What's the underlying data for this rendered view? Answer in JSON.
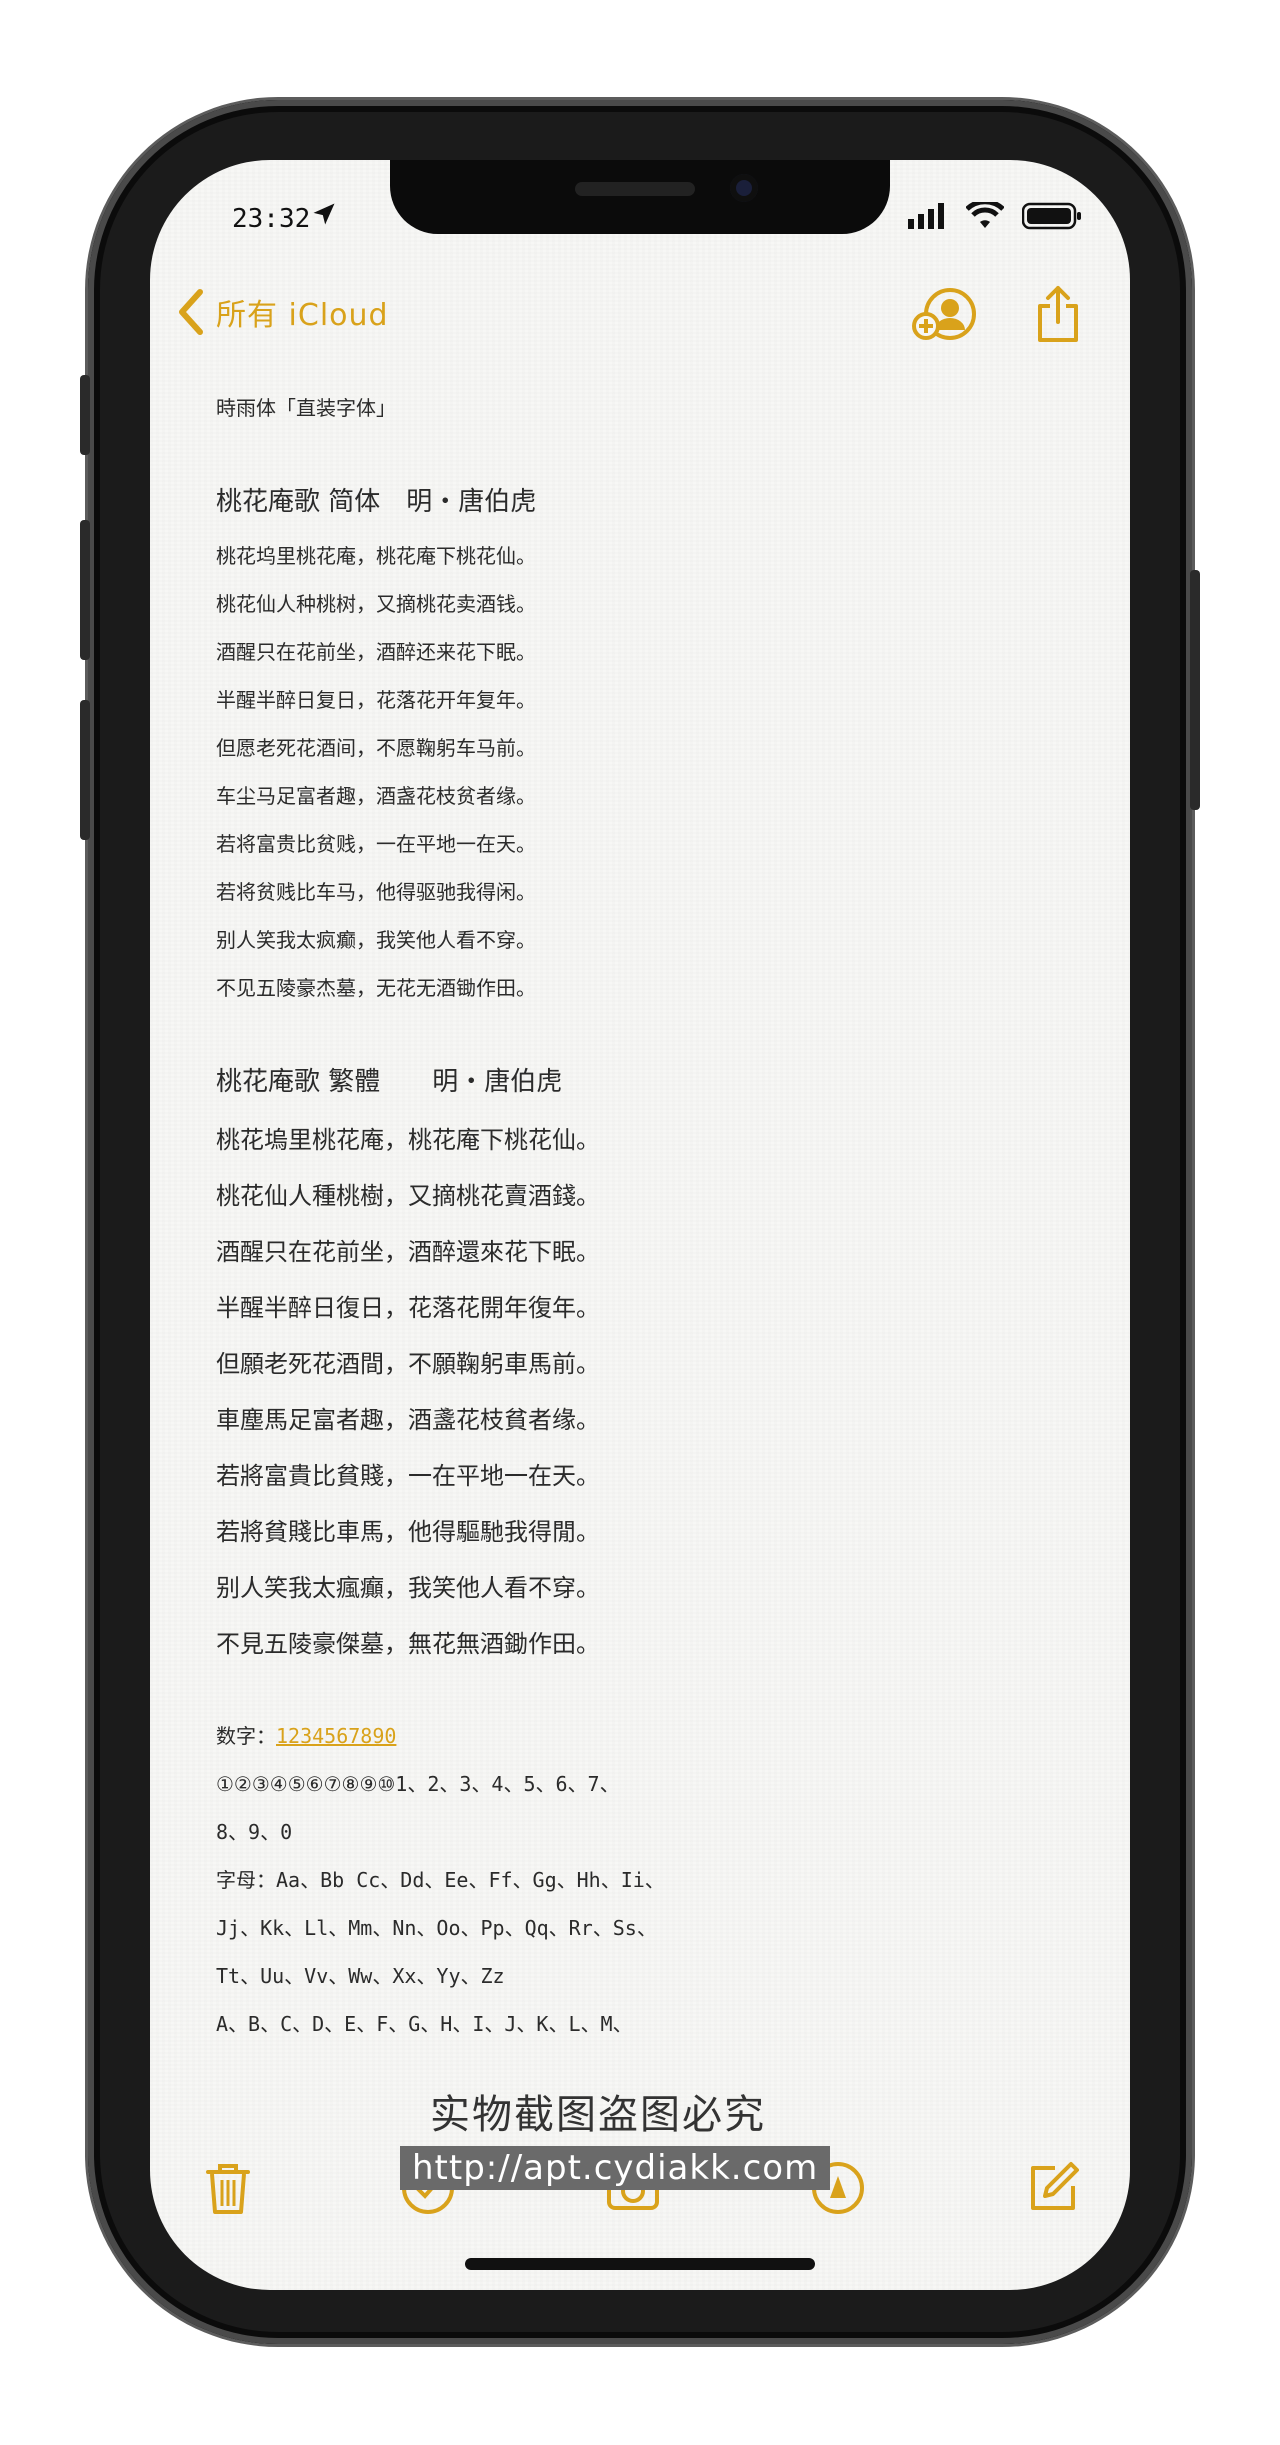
{
  "status": {
    "time": "23:32"
  },
  "nav": {
    "back_label": "所有 iCloud"
  },
  "note": {
    "font_line": "時雨体「直装字体」",
    "simplified_title": "桃花庵歌 简体　明・唐伯虎",
    "simplified_lines": [
      "桃花坞里桃花庵，桃花庵下桃花仙。",
      "桃花仙人种桃树，又摘桃花卖酒钱。",
      "酒醒只在花前坐，酒醉还来花下眠。",
      "半醒半醉日复日，花落花开年复年。",
      "但愿老死花酒间，不愿鞠躬车马前。",
      "车尘马足富者趣，酒盏花枝贫者缘。",
      "若将富贵比贫贱，一在平地一在天。",
      "若将贫贱比车马，他得驱驰我得闲。",
      "别人笑我太疯癫，我笑他人看不穿。",
      "不见五陵豪杰墓，无花无酒锄作田。"
    ],
    "traditional_title": "桃花庵歌 繁體　　明・唐伯虎",
    "traditional_lines": [
      "桃花塢里桃花庵，桃花庵下桃花仙。",
      "桃花仙人種桃樹，又摘桃花賣酒錢。",
      "酒醒只在花前坐，酒醉還來花下眠。",
      "半醒半醉日復日，花落花開年復年。",
      "但願老死花酒間，不願鞠躬車馬前。",
      "車塵馬足富者趣，酒盞花枝貧者缘。",
      "若將富貴比貧賤，一在平地一在天。",
      "若將貧賤比車馬，他得驅馳我得閒。",
      "别人笑我太瘋癲，我笑他人看不穿。",
      "不見五陵豪傑墓，無花無酒鋤作田。"
    ],
    "digits_label": "数字：",
    "digits_link": "1234567890",
    "digits_line1": "①②③④⑤⑥⑦⑧⑨⑩1、2、3、4、5、6、7、",
    "digits_line2": "8、9、0",
    "letters_line1": "字母：Aa、Bb Cc、Dd、Ee、Ff、Gg、Hh、Ii、",
    "letters_line2": "Jj、Kk、Ll、Mm、Nn、Oo、Pp、Qq、Rr、Ss、",
    "letters_line3": "Tt、Uu、Vv、Ww、Xx、Yy、Zz",
    "letters_line4": "A、B、C、D、E、F、G、H、I、J、K、L、M、"
  },
  "watermark": {
    "line1": "实物截图盗图必究",
    "line2": "http://apt.cydiakk.com"
  },
  "colors": {
    "accent": "#d9a21b"
  }
}
